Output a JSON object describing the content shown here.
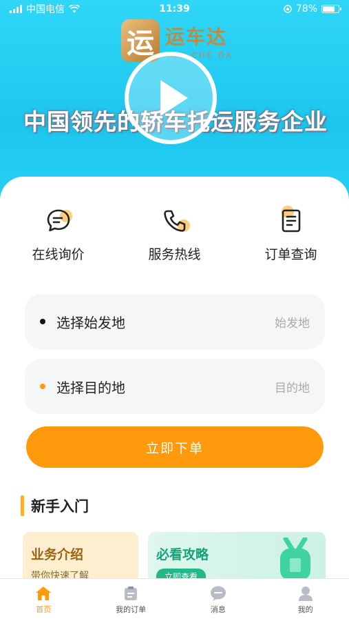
{
  "status_bar": {
    "carrier": "中国电信",
    "time": "11:39",
    "battery": "78%",
    "battery_level": 0.78
  },
  "hero": {
    "logo_char": "运",
    "logo_name": "运车达",
    "logo_en": "YUN CHE DA",
    "slogan": "中国领先的轿车托运服务企业"
  },
  "quick_actions": [
    {
      "label": "在线询价",
      "icon": "chat-bubble-icon"
    },
    {
      "label": "服务热线",
      "icon": "phone-icon"
    },
    {
      "label": "订单查询",
      "icon": "document-icon"
    }
  ],
  "form": {
    "origin_label": "选择始发地",
    "origin_hint": "始发地",
    "destination_label": "选择目的地",
    "destination_hint": "目的地",
    "submit_label": "立即下单"
  },
  "beginner": {
    "title": "新手入门",
    "cards": [
      {
        "title": "业务介绍",
        "subtitle": "带你快速了解"
      },
      {
        "title": "必看攻略",
        "button": "立即查看"
      }
    ]
  },
  "tab_bar": {
    "items": [
      {
        "label": "首页",
        "icon": "home-icon",
        "active": true
      },
      {
        "label": "我的订单",
        "icon": "order-list-icon",
        "active": false
      },
      {
        "label": "消息",
        "icon": "message-icon",
        "active": false
      },
      {
        "label": "我的",
        "icon": "user-icon",
        "active": false
      }
    ]
  },
  "colors": {
    "hero_bg": "#1ec6ee",
    "accent_orange": "#ff9a0d",
    "accent_yellow": "#ffb01c",
    "guide_green": "#21b98a"
  }
}
